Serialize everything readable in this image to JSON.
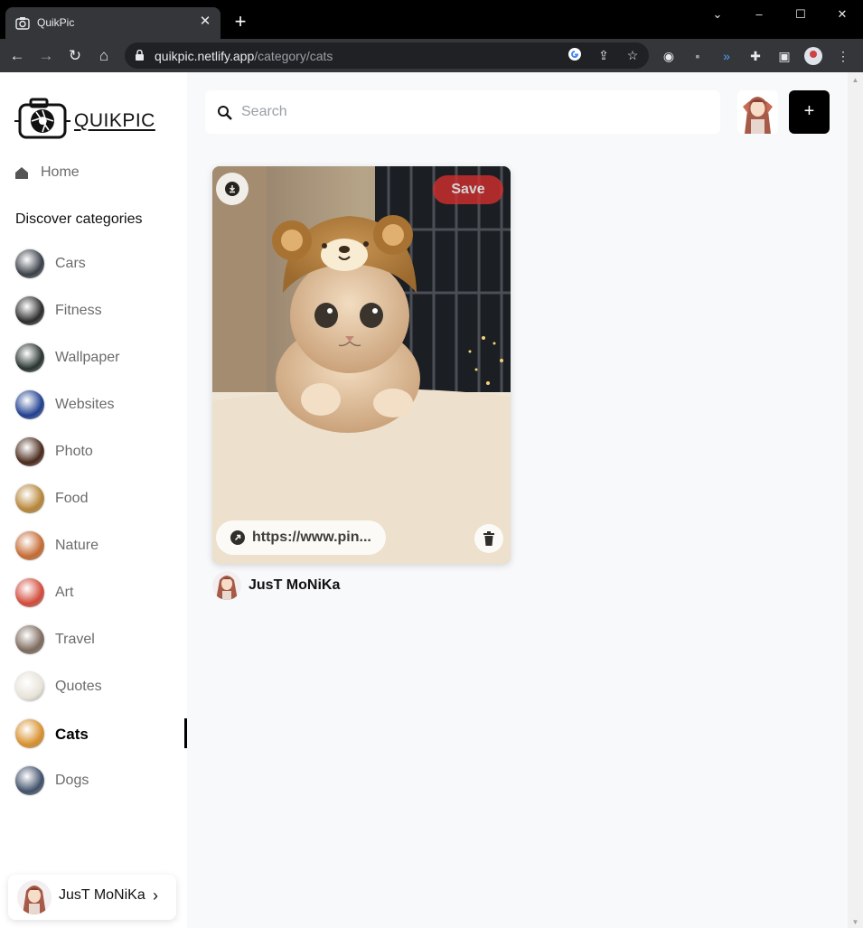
{
  "browser": {
    "tab_title": "QuikPic",
    "url_domain": "quikpic.netlify.app",
    "url_path": "/category/cats"
  },
  "app": {
    "logo_text": "QUIKPIC",
    "home_label": "Home",
    "discover_label": "Discover categories",
    "categories": [
      {
        "name": "Cars",
        "color": "#3a3f48"
      },
      {
        "name": "Fitness",
        "color": "#2b2b2b"
      },
      {
        "name": "Wallpaper",
        "color": "#28332e"
      },
      {
        "name": "Websites",
        "color": "#1f3f8f"
      },
      {
        "name": "Photo",
        "color": "#4a2a1c"
      },
      {
        "name": "Food",
        "color": "#b78537"
      },
      {
        "name": "Nature",
        "color": "#c56a32"
      },
      {
        "name": "Art",
        "color": "#d24a3a"
      },
      {
        "name": "Travel",
        "color": "#7c6a5d"
      },
      {
        "name": "Quotes",
        "color": "#e7e3d8"
      },
      {
        "name": "Cats",
        "color": "#d8902c"
      },
      {
        "name": "Dogs",
        "color": "#40506a"
      }
    ],
    "active_category": "Cats",
    "user_name": "JusT MoNiKa"
  },
  "main": {
    "search_placeholder": "Search",
    "add_label": "+",
    "pin": {
      "save_label": "Save",
      "link_text": "https://www.pin...",
      "author": "JusT MoNiKa"
    }
  }
}
